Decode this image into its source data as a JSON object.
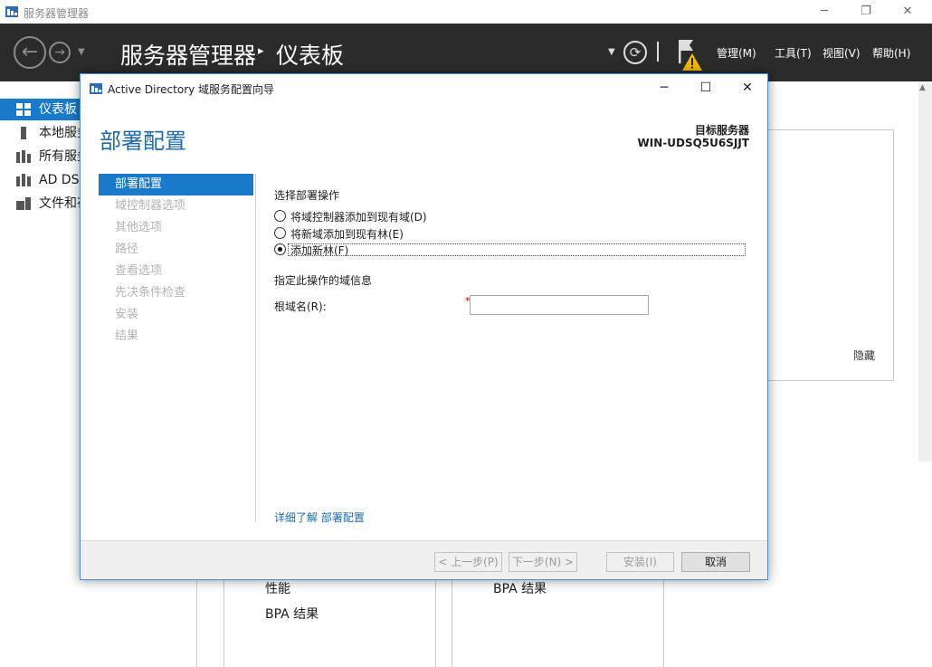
{
  "server_manager": {
    "window_title": "服务器管理器",
    "header_title": "服务器管理器",
    "breadcrumb_arrow": "▸",
    "current_page": "仪表板",
    "menus": [
      "管理(M)",
      "工具(T)",
      "视图(V)",
      "帮助(H)"
    ],
    "sidebar": [
      {
        "label": "仪表板",
        "icon": "dashboard-icon",
        "selected": true
      },
      {
        "label": "本地服务器",
        "icon": "local-server-icon",
        "selected": false
      },
      {
        "label": "所有服务器",
        "icon": "all-servers-icon",
        "selected": false
      },
      {
        "label": "AD DS",
        "icon": "ad-ds-icon",
        "selected": false
      },
      {
        "label": "文件和存储服务",
        "icon": "file-storage-icon",
        "selected": false
      }
    ],
    "hide_link": "隐藏",
    "tiles": {
      "left": [
        "性能",
        "BPA 结果"
      ],
      "right": [
        "BPA 结果"
      ]
    }
  },
  "dialog": {
    "title": "Active Directory 域服务配置向导",
    "heading": "部署配置",
    "target_label": "目标服务器",
    "target_name": "WIN-UDSQ5U6SJJT",
    "steps": [
      {
        "label": "部署配置",
        "selected": true
      },
      {
        "label": "域控制器选项",
        "selected": false
      },
      {
        "label": "其他选项",
        "selected": false
      },
      {
        "label": "路径",
        "selected": false
      },
      {
        "label": "查看选项",
        "selected": false
      },
      {
        "label": "先决条件检查",
        "selected": false
      },
      {
        "label": "安装",
        "selected": false
      },
      {
        "label": "结果",
        "selected": false
      }
    ],
    "section_title": "选择部署操作",
    "options": [
      {
        "label": "将域控制器添加到现有域(D)",
        "checked": false
      },
      {
        "label": "将新域添加到现有林(E)",
        "checked": false
      },
      {
        "label": "添加新林(F)",
        "checked": true
      }
    ],
    "domain_info_label": "指定此操作的域信息",
    "root_domain_label": "根域名(R):",
    "required_marker": "*",
    "root_domain_value": "",
    "learn_more": "详细了解 部署配置",
    "buttons": {
      "prev": "< 上一步(P)",
      "next": "下一步(N) >",
      "install": "安装(I)",
      "cancel": "取消"
    }
  }
}
